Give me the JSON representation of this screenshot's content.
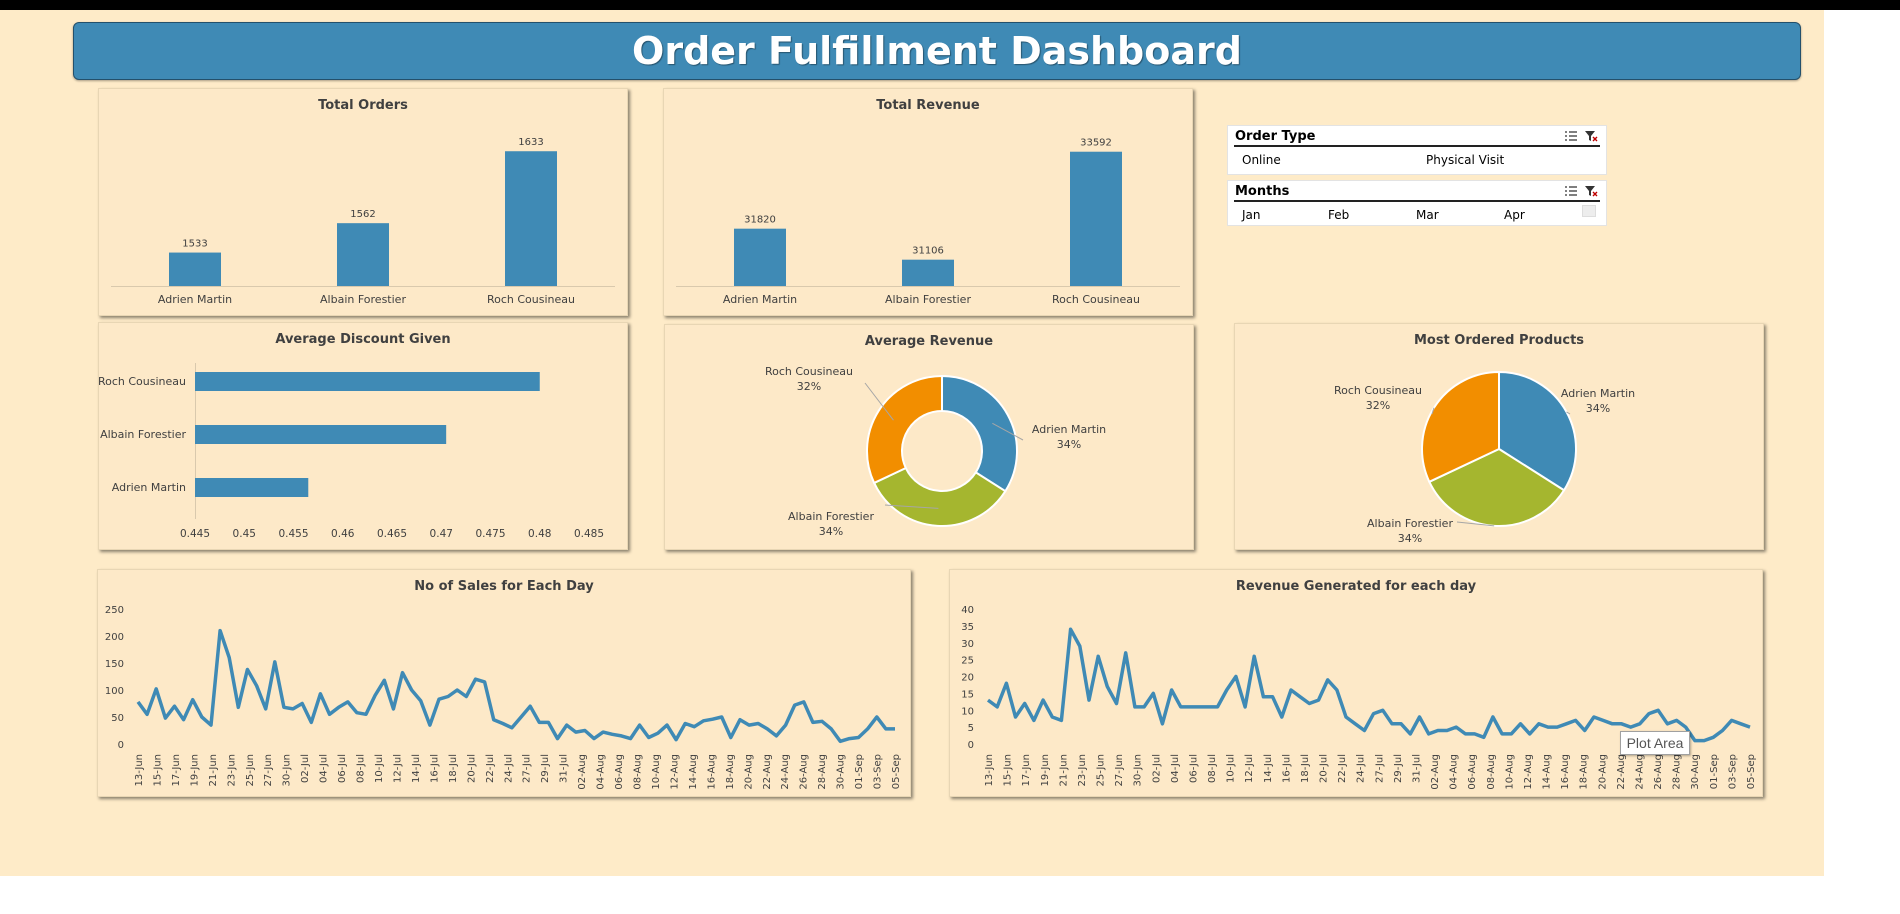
{
  "header": {
    "title": "Order Fulfillment Dashboard"
  },
  "colors": {
    "bar": "#3f8ab5",
    "orange": "#f28e00",
    "green": "#a5b62f",
    "blue": "#3f8ab5",
    "background": "#feebc8"
  },
  "slicers": {
    "order_type": {
      "title": "Order Type",
      "items": [
        "Online",
        "Physical Visit"
      ],
      "icons": [
        "multi-select-icon",
        "clear-filter-icon"
      ]
    },
    "months": {
      "title": "Months",
      "items": [
        "Jan",
        "Feb",
        "Mar",
        "Apr"
      ],
      "icons": [
        "multi-select-icon",
        "clear-filter-icon"
      ]
    }
  },
  "tooltip": {
    "text": "Plot Area"
  },
  "chart_data": [
    {
      "id": "total_orders",
      "type": "bar",
      "title": "Total Orders",
      "categories": [
        "Adrien Martin",
        "Albain Forestier",
        "Roch Cousineau"
      ],
      "values": [
        1533,
        1562,
        1633
      ],
      "data_labels": [
        "1533",
        "1562",
        "1633"
      ],
      "ylim": [
        1500,
        1650
      ]
    },
    {
      "id": "total_revenue",
      "type": "bar",
      "title": "Total Revenue",
      "categories": [
        "Adrien Martin",
        "Albain Forestier",
        "Roch Cousineau"
      ],
      "values": [
        31820,
        31106,
        33592
      ],
      "data_labels": [
        "31820",
        "31106",
        "33592"
      ],
      "ylim": [
        30500,
        34000
      ]
    },
    {
      "id": "avg_discount",
      "type": "bar",
      "orientation": "horizontal",
      "title": "Average Discount Given",
      "categories": [
        "Roch Cousineau",
        "Albain Forestier",
        "Adrien Martin"
      ],
      "values": [
        0.48,
        0.4705,
        0.4565
      ],
      "xlim": [
        0.445,
        0.485
      ],
      "x_ticks": [
        "0.445",
        "0.45",
        "0.455",
        "0.46",
        "0.465",
        "0.47",
        "0.475",
        "0.48",
        "0.485"
      ]
    },
    {
      "id": "avg_revenue",
      "type": "pie",
      "variant": "donut",
      "title": "Average Revenue",
      "slices": [
        {
          "label": "Adrien Martin",
          "percent_label": "34%",
          "value": 34,
          "color": "#3f8ab5"
        },
        {
          "label": "Albain Forestier",
          "percent_label": "34%",
          "value": 34,
          "color": "#a5b62f"
        },
        {
          "label": "Roch Cousineau",
          "percent_label": "32%",
          "value": 32,
          "color": "#f28e00"
        }
      ]
    },
    {
      "id": "most_ordered",
      "type": "pie",
      "title": "Most Ordered Products",
      "slices": [
        {
          "label": "Adrien Martin",
          "percent_label": "34%",
          "value": 34,
          "color": "#3f8ab5"
        },
        {
          "label": "Albain Forestier",
          "percent_label": "34%",
          "value": 34,
          "color": "#a5b62f"
        },
        {
          "label": "Roch Cousineau",
          "percent_label": "32%",
          "value": 32,
          "color": "#f28e00"
        }
      ]
    },
    {
      "id": "sales_per_day",
      "type": "line",
      "title": "No of Sales for Each Day",
      "ylim": [
        0,
        250
      ],
      "y_ticks": [
        "0",
        "50",
        "100",
        "150",
        "200",
        "250"
      ],
      "x_tick_labels": [
        "13-Jun",
        "15-Jun",
        "17-Jun",
        "19-Jun",
        "21-Jun",
        "23-Jun",
        "25-Jun",
        "27-Jun",
        "30-Jun",
        "02-Jul",
        "04-Jul",
        "06-Jul",
        "08-Jul",
        "10-Jul",
        "12-Jul",
        "14-Jul",
        "16-Jul",
        "18-Jul",
        "20-Jul",
        "22-Jul",
        "24-Jul",
        "27-Jul",
        "29-Jul",
        "31-Jul",
        "02-Aug",
        "04-Aug",
        "06-Aug",
        "08-Aug",
        "10-Aug",
        "12-Aug",
        "14-Aug",
        "16-Aug",
        "18-Aug",
        "20-Aug",
        "22-Aug",
        "24-Aug",
        "26-Aug",
        "28-Aug",
        "30-Aug",
        "01-Sep",
        "03-Sep",
        "05-Sep"
      ],
      "values": [
        78,
        55,
        102,
        48,
        70,
        45,
        82,
        50,
        35,
        210,
        160,
        68,
        138,
        108,
        65,
        152,
        68,
        65,
        75,
        40,
        93,
        55,
        68,
        78,
        58,
        55,
        90,
        118,
        65,
        132,
        100,
        80,
        35,
        83,
        88,
        100,
        88,
        120,
        115,
        45,
        38,
        30,
        50,
        70,
        40,
        40,
        10,
        35,
        22,
        25,
        10,
        22,
        18,
        15,
        10,
        35,
        12,
        20,
        35,
        8,
        38,
        32,
        43,
        46,
        50,
        12,
        45,
        35,
        38,
        28,
        15,
        35,
        72,
        78,
        40,
        42,
        28,
        5,
        10,
        12,
        28,
        50,
        28,
        28
      ]
    },
    {
      "id": "revenue_per_day",
      "type": "line",
      "title": "Revenue Generated for each day",
      "ylim": [
        0,
        40
      ],
      "y_ticks": [
        "0",
        "5",
        "10",
        "15",
        "20",
        "25",
        "30",
        "35",
        "40"
      ],
      "x_tick_labels": [
        "13-Jun",
        "15-Jun",
        "17-Jun",
        "19-Jun",
        "21-Jun",
        "23-Jun",
        "25-Jun",
        "27-Jun",
        "30-Jun",
        "02-Jul",
        "04-Jul",
        "06-Jul",
        "08-Jul",
        "10-Jul",
        "12-Jul",
        "14-Jul",
        "16-Jul",
        "18-Jul",
        "20-Jul",
        "22-Jul",
        "24-Jul",
        "27-Jul",
        "29-Jul",
        "31-Jul",
        "02-Aug",
        "04-Aug",
        "06-Aug",
        "08-Aug",
        "10-Aug",
        "12-Aug",
        "14-Aug",
        "16-Aug",
        "18-Aug",
        "20-Aug",
        "22-Aug",
        "24-Aug",
        "26-Aug",
        "28-Aug",
        "30-Aug",
        "01-Sep",
        "03-Sep",
        "05-Sep"
      ],
      "values": [
        13,
        11,
        18,
        8,
        12,
        7,
        13,
        8,
        7,
        34,
        29,
        13,
        26,
        17,
        12,
        27,
        11,
        11,
        15,
        6,
        16,
        11,
        11,
        11,
        11,
        11,
        16,
        20,
        11,
        26,
        14,
        14,
        8,
        16,
        14,
        12,
        13,
        19,
        16,
        8,
        6,
        4,
        9,
        10,
        6,
        6,
        3,
        8,
        3,
        4,
        4,
        5,
        3,
        3,
        2,
        8,
        3,
        3,
        6,
        3,
        6,
        5,
        5,
        6,
        7,
        4,
        8,
        7,
        6,
        6,
        5,
        6,
        9,
        10,
        6,
        7,
        5,
        1,
        1,
        2,
        4,
        7,
        6,
        5
      ]
    }
  ]
}
